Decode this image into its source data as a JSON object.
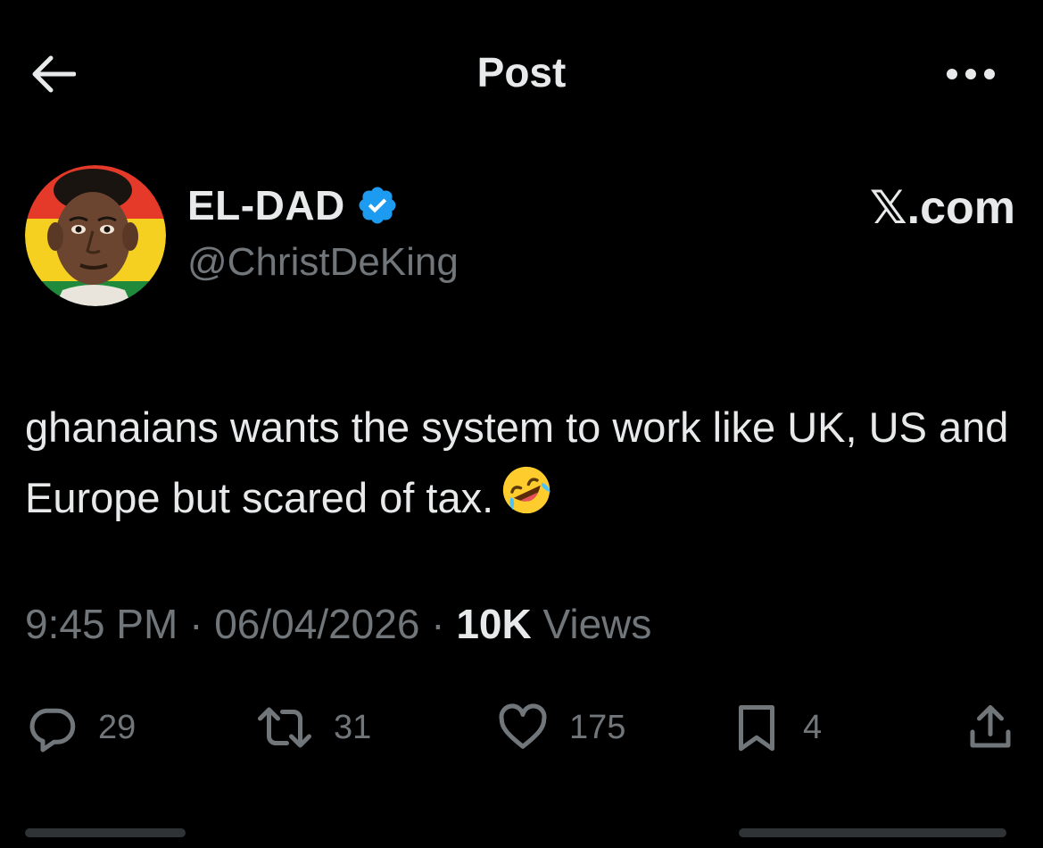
{
  "header": {
    "title": "Post",
    "back_icon": "arrow-left-icon",
    "more_icon": "more-horizontal-icon"
  },
  "author": {
    "display_name": "EL-DAD",
    "handle": "@ChristDeKing",
    "verified_icon": "verified-badge-icon",
    "avatar_colors": [
      "#e53a2a",
      "#f5d021",
      "#1f8a3b"
    ]
  },
  "brand_label": "𝕏.com",
  "post": {
    "text": "ghanaians wants the system to work like UK, US and Europe but scared of tax.",
    "emoji_icon": "rolling-on-floor-laughing-emoji"
  },
  "meta": {
    "time": "9:45 PM",
    "separator": " · ",
    "date": "06/04/2026",
    "views_count": "10K",
    "views_label": "Views"
  },
  "actions": {
    "replies": "29",
    "reposts": "31",
    "likes": "175",
    "bookmarks": "4"
  },
  "colors": {
    "background": "#000000",
    "text_primary": "#e7e9ea",
    "text_secondary": "#71767b",
    "verified_blue": "#1d9bf0"
  }
}
